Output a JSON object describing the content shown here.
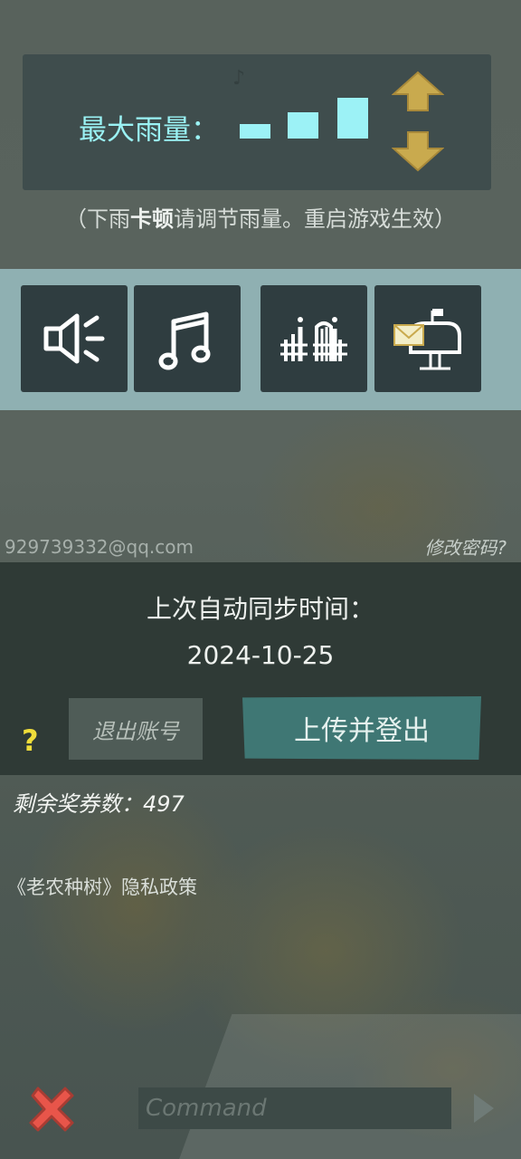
{
  "rain": {
    "label": "最大雨量：",
    "hint_prefix": "（下雨",
    "hint_bold": "卡顿",
    "hint_suffix": "请调节雨量。重启游戏生效）",
    "level": 3,
    "levels_total": 3,
    "bar_color": "#9cf2f6"
  },
  "toolbar": {
    "icons": [
      "sound-icon",
      "music-icon",
      "fence-gate-icon",
      "mailbox-icon"
    ]
  },
  "account": {
    "email": "929739332@qq.com",
    "change_password": "修改密码?"
  },
  "sync": {
    "title": "上次自动同步时间：",
    "date": "2024-10-25",
    "help": "?",
    "logout_label": "退出账号",
    "upload_label": "上传并登出"
  },
  "vouchers": {
    "text": "剩余奖券数：497"
  },
  "privacy": {
    "text": "《老农种树》隐私政策"
  },
  "console": {
    "placeholder": "Command"
  },
  "colors": {
    "accent_teal": "#3f7774",
    "arrow_gold": "#c9aa4e",
    "close_red": "#e8554a",
    "help_yellow": "#f0dd3a"
  }
}
